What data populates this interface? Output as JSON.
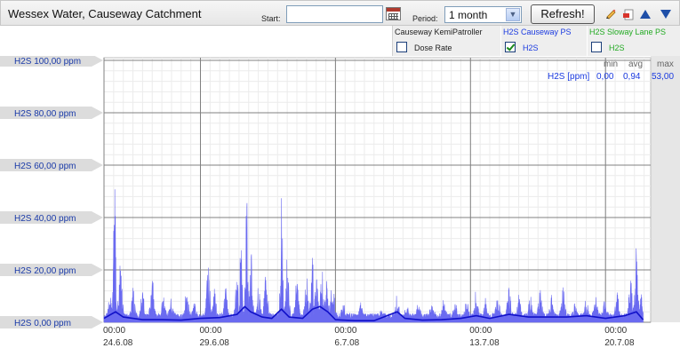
{
  "header": {
    "title": "Wessex Water, Causeway Catchment",
    "start_label": "Start:",
    "start_value": "",
    "period_label": "Period:",
    "period_value": "1 month",
    "refresh_label": "Refresh!"
  },
  "legend": [
    {
      "name": "Causeway KemiPatroller",
      "sub": "Dose Rate",
      "checked": false,
      "color": "#222222"
    },
    {
      "name": "H2S Causeway PS",
      "sub": "H2S",
      "checked": true,
      "color": "#1a3ae0"
    },
    {
      "name": "H2S Sloway Lane PS",
      "sub": "H2S",
      "checked": false,
      "color": "#22aa22"
    }
  ],
  "stats": {
    "headers": [
      "min",
      "avg",
      "max"
    ],
    "row_label": "H2S [ppm]",
    "values": [
      "0,00",
      "0,94",
      "53,00"
    ]
  },
  "colors": {
    "series_fill": "#6a6af0",
    "series_line": "#1010c8",
    "axis_label": "#1a3aa8",
    "tab_bg": "#dcdcdc"
  },
  "chart_data": {
    "type": "area",
    "series": [
      {
        "name": "H2S",
        "unit": "ppm"
      }
    ],
    "ylim": [
      0,
      100
    ],
    "y_ticks": [
      {
        "value": 0,
        "label": "H2S 0,00 ppm"
      },
      {
        "value": 20,
        "label": "H2S 20,00 ppm"
      },
      {
        "value": 40,
        "label": "H2S 40,00 ppm"
      },
      {
        "value": 60,
        "label": "H2S 60,00 ppm"
      },
      {
        "value": 80,
        "label": "H2S 80,00 ppm"
      },
      {
        "value": 100,
        "label": "H2S 100,00 ppm"
      }
    ],
    "x_ticks": [
      {
        "day": 0,
        "time": "00:00",
        "date": "24.6.08"
      },
      {
        "day": 5,
        "time": "00:00",
        "date": "29.6.08"
      },
      {
        "day": 12,
        "time": "00:00",
        "date": "6.7.08"
      },
      {
        "day": 19,
        "time": "00:00",
        "date": "13.7.08"
      },
      {
        "day": 26,
        "time": "00:00",
        "date": "20.7.08"
      }
    ],
    "xlim": [
      0,
      28.2
    ],
    "data_end_day": 27.95,
    "peaks": [
      {
        "day": 0.3,
        "value": 8
      },
      {
        "day": 0.55,
        "value": 51
      },
      {
        "day": 0.85,
        "value": 24
      },
      {
        "day": 1.5,
        "value": 12
      },
      {
        "day": 2.0,
        "value": 10
      },
      {
        "day": 2.5,
        "value": 15
      },
      {
        "day": 3.1,
        "value": 10
      },
      {
        "day": 3.5,
        "value": 7
      },
      {
        "day": 4.3,
        "value": 13
      },
      {
        "day": 4.7,
        "value": 6
      },
      {
        "day": 5.4,
        "value": 20
      },
      {
        "day": 5.7,
        "value": 13
      },
      {
        "day": 6.3,
        "value": 11
      },
      {
        "day": 6.9,
        "value": 16
      },
      {
        "day": 7.1,
        "value": 31
      },
      {
        "day": 7.4,
        "value": 53
      },
      {
        "day": 7.6,
        "value": 28
      },
      {
        "day": 8.0,
        "value": 13
      },
      {
        "day": 8.4,
        "value": 21
      },
      {
        "day": 9.2,
        "value": 47
      },
      {
        "day": 9.5,
        "value": 22
      },
      {
        "day": 10.0,
        "value": 16
      },
      {
        "day": 10.5,
        "value": 17
      },
      {
        "day": 10.8,
        "value": 22
      },
      {
        "day": 11.0,
        "value": 20
      },
      {
        "day": 11.3,
        "value": 23
      },
      {
        "day": 11.55,
        "value": 20
      },
      {
        "day": 11.85,
        "value": 15
      },
      {
        "day": 12.4,
        "value": 5
      },
      {
        "day": 13.3,
        "value": 6
      },
      {
        "day": 14.4,
        "value": 3
      },
      {
        "day": 15.2,
        "value": 8
      },
      {
        "day": 15.7,
        "value": 5
      },
      {
        "day": 16.3,
        "value": 5
      },
      {
        "day": 17.0,
        "value": 6
      },
      {
        "day": 17.6,
        "value": 7
      },
      {
        "day": 18.2,
        "value": 5
      },
      {
        "day": 18.8,
        "value": 7
      },
      {
        "day": 19.3,
        "value": 10
      },
      {
        "day": 19.8,
        "value": 7
      },
      {
        "day": 20.4,
        "value": 10
      },
      {
        "day": 21.0,
        "value": 12
      },
      {
        "day": 21.5,
        "value": 9
      },
      {
        "day": 22.1,
        "value": 8
      },
      {
        "day": 22.6,
        "value": 11
      },
      {
        "day": 23.2,
        "value": 8
      },
      {
        "day": 23.8,
        "value": 12
      },
      {
        "day": 24.4,
        "value": 6
      },
      {
        "day": 25.0,
        "value": 10
      },
      {
        "day": 25.5,
        "value": 7
      },
      {
        "day": 26.0,
        "value": 9
      },
      {
        "day": 26.6,
        "value": 11
      },
      {
        "day": 27.3,
        "value": 14
      },
      {
        "day": 27.6,
        "value": 26
      },
      {
        "day": 27.85,
        "value": 8
      }
    ],
    "mean_line": [
      {
        "day": 0.0,
        "value": 1.5
      },
      {
        "day": 0.6,
        "value": 4
      },
      {
        "day": 1.0,
        "value": 2
      },
      {
        "day": 2.0,
        "value": 1
      },
      {
        "day": 3.0,
        "value": 1
      },
      {
        "day": 4.0,
        "value": 0.8
      },
      {
        "day": 5.0,
        "value": 1.5
      },
      {
        "day": 6.0,
        "value": 1.8
      },
      {
        "day": 6.9,
        "value": 3
      },
      {
        "day": 7.3,
        "value": 6
      },
      {
        "day": 7.6,
        "value": 4
      },
      {
        "day": 8.2,
        "value": 2
      },
      {
        "day": 8.7,
        "value": 1.5
      },
      {
        "day": 9.2,
        "value": 5
      },
      {
        "day": 9.6,
        "value": 2
      },
      {
        "day": 10.3,
        "value": 1.5
      },
      {
        "day": 10.8,
        "value": 5
      },
      {
        "day": 11.2,
        "value": 6
      },
      {
        "day": 11.6,
        "value": 4
      },
      {
        "day": 12.0,
        "value": 1
      },
      {
        "day": 13.0,
        "value": 0.6
      },
      {
        "day": 14.0,
        "value": 0.6
      },
      {
        "day": 15.2,
        "value": 4
      },
      {
        "day": 15.6,
        "value": 1.5
      },
      {
        "day": 16.5,
        "value": 0.8
      },
      {
        "day": 17.5,
        "value": 1
      },
      {
        "day": 18.5,
        "value": 1.5
      },
      {
        "day": 19.3,
        "value": 2.5
      },
      {
        "day": 20.0,
        "value": 1.5
      },
      {
        "day": 21.0,
        "value": 3
      },
      {
        "day": 22.0,
        "value": 2
      },
      {
        "day": 23.0,
        "value": 2
      },
      {
        "day": 24.0,
        "value": 2
      },
      {
        "day": 25.0,
        "value": 2.5
      },
      {
        "day": 26.0,
        "value": 1.5
      },
      {
        "day": 27.0,
        "value": 2.5
      },
      {
        "day": 27.6,
        "value": 4
      },
      {
        "day": 27.95,
        "value": 1
      }
    ]
  }
}
